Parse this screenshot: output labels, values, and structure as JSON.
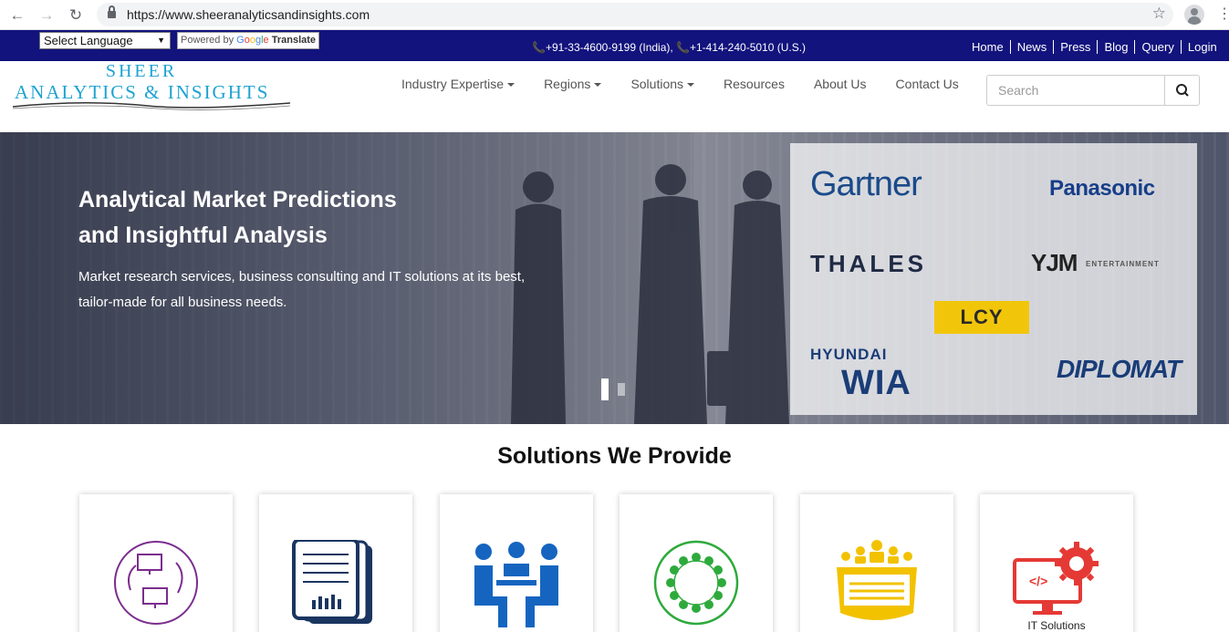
{
  "browser": {
    "url": "https://www.sheeranalyticsandinsights.com",
    "back": "←",
    "forward": "→",
    "reload": "↻",
    "bookmark": "☆",
    "menu": "⋮"
  },
  "topbar": {
    "language_select": "Select Language",
    "powered_by": "Powered by",
    "translate": "Translate",
    "phones": "📞+91-33-4600-9199 (India), 📞+1-414-240-5010 (U.S.)",
    "links": [
      "Home",
      "News",
      "Press",
      "Blog",
      "Query",
      "Login"
    ],
    "color": "#12137d"
  },
  "header": {
    "logo_top": "SHEER",
    "logo_bottom": "ANALYTICS & INSIGHTS",
    "logo_color": "#1ea2d1",
    "nav": [
      {
        "label": "Industry Expertise",
        "dropdown": true
      },
      {
        "label": "Regions",
        "dropdown": true
      },
      {
        "label": "Solutions",
        "dropdown": true
      },
      {
        "label": "Resources",
        "dropdown": false
      },
      {
        "label": "About Us",
        "dropdown": false
      },
      {
        "label": "Contact Us",
        "dropdown": false
      }
    ],
    "search_placeholder": "Search"
  },
  "hero": {
    "title_line1": "Analytical Market Predictions",
    "title_line2": "and Insightful Analysis",
    "subtitle_line1": "Market research services, business consulting and IT solutions at its best,",
    "subtitle_line2": "tailor-made for all business needs.",
    "clients": {
      "gartner": "Gartner",
      "panasonic": "Panasonic",
      "thales": "THALES",
      "yjm": "YJM",
      "yjm_sub": "ENTERTAINMENT",
      "lcy": "LCY",
      "hyundai": "HYUNDAI",
      "wia": "WIA",
      "diplomat": "DIPLOMAT"
    },
    "slides_total": 2,
    "active_slide": 1
  },
  "solutions": {
    "title": "Solutions We Provide",
    "cards": [
      {
        "icon": "computer-sync-icon",
        "color": "#7b2d8e",
        "label": ""
      },
      {
        "icon": "report-document-icon",
        "color": "#1a3560",
        "label": ""
      },
      {
        "icon": "team-meeting-icon",
        "color": "#1565c0",
        "label": ""
      },
      {
        "icon": "network-circle-icon",
        "color": "#2eaa3c",
        "label": ""
      },
      {
        "icon": "conference-table-icon",
        "color": "#f2c200",
        "label": ""
      },
      {
        "icon": "it-code-gear-icon",
        "color": "#e53935",
        "label": "IT Solutions"
      }
    ]
  }
}
